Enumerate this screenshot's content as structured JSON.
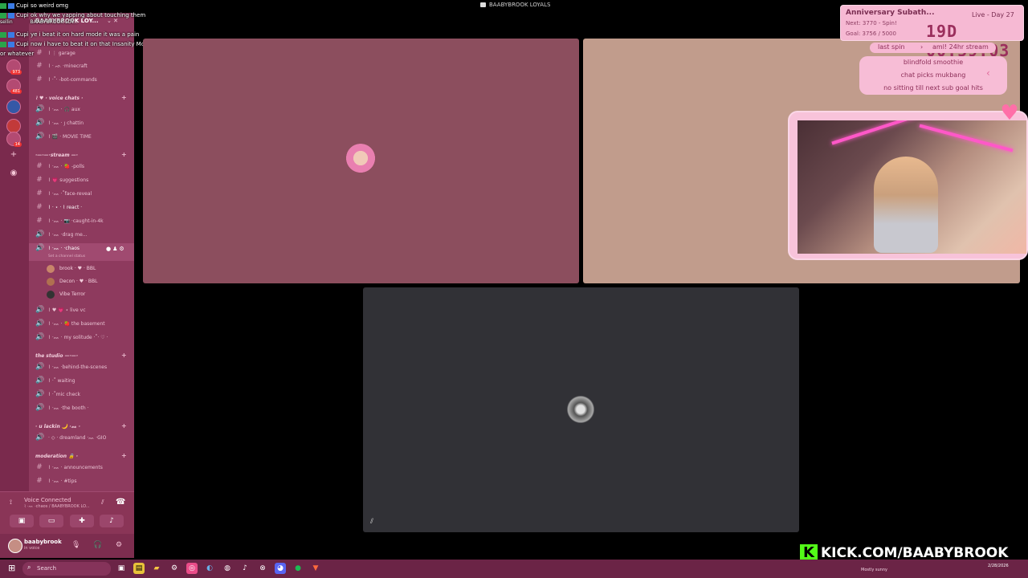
{
  "window": {
    "title": "BAABYBROOK LOYALS"
  },
  "chat": [
    {
      "user": "Cupi",
      "text": "so weird omg"
    },
    {
      "user": "Cupi",
      "text": "ok why we yapping about touching them"
    },
    {
      "user": "Cupi",
      "text": "ye i beat it on hard mode it was a pain"
    },
    {
      "user": "Cupi",
      "text": "now i have to beat it on that Insanity Mode"
    },
    {
      "user": "",
      "text": "or whatever"
    }
  ],
  "chat_extra": {
    "stray_left": "sellin",
    "server_header_overlap": "BAABYBROOK LOY..."
  },
  "server_rail": {
    "badges": [
      "973",
      "481",
      "14"
    ]
  },
  "sidebar": {
    "server_name": "BAABYBROOK LOY...",
    "channels_top": [
      {
        "icon": "#",
        "label": "⌇ ⋮ garage"
      },
      {
        "icon": "#",
        "label": "⌇ · ᨒ ·minecraft"
      },
      {
        "icon": "#",
        "label": "⌇ ·˚· -bot-commands"
      }
    ],
    "cat_voice": "⌇ ♥ · voice chats ·",
    "channels_voice": [
      {
        "icon": "🔊",
        "label": "⌇ ·ᨐ · 🎧 aux"
      },
      {
        "icon": "🔊",
        "label": "⌇ ·ᨐ · ȷ chattin"
      },
      {
        "icon": "🔊",
        "label": "⌇ 🎬 · MOVIE TIME"
      }
    ],
    "cat_stream": "·—·—·stream —·",
    "channels_stream": [
      {
        "icon": "#",
        "label": "⌇ ·ᨐ · 🍓 -polls"
      },
      {
        "icon": "#",
        "label": "⌇ 💗 suggestions"
      },
      {
        "icon": "#",
        "label": "⌇ ·ᨐ ·˚face-reveal"
      },
      {
        "icon": "#",
        "label": "⌇ · ⋆ · ⌇ react ·"
      },
      {
        "icon": "#",
        "label": "⌇ ·ᨐ · 📷 ·caught-in-4k"
      },
      {
        "icon": "🔊",
        "label": "⌇ ·ᨐ ·drag me..."
      },
      {
        "icon": "🔊",
        "label": "⌇ ·ᨐ · ·chaos"
      }
    ],
    "active_status": "Set a channel status",
    "voice_members": [
      {
        "name": "brook · ♥ · BBL"
      },
      {
        "name": "Decon · ♥ · BBL"
      },
      {
        "name": "Vibe Terror"
      }
    ],
    "channels_after": [
      {
        "icon": "🔊",
        "label": "⌇ ♥ 💗 ⋆ live vc"
      },
      {
        "icon": "🔊",
        "label": "⌇ ·ᨐ · 🍓 the basement"
      },
      {
        "icon": "🔊",
        "label": "⌇ ·ᨐ · my solitude ·˚· ♡ ·"
      }
    ],
    "cat_studio": "the studio —·—·",
    "channels_studio": [
      {
        "icon": "🔊",
        "label": "⌇ ·ᨐ ·behind-the-scenes"
      },
      {
        "icon": "🔊",
        "label": "⌇ ·˚ waiting"
      },
      {
        "icon": "🔊",
        "label": "⌇ ·˚mic check"
      },
      {
        "icon": "🔊",
        "label": "⌇ ·ᨐ ·the booth ·"
      }
    ],
    "cat_lackin": "· u lackin 🌙 ·ᨐ ·",
    "channels_lackin": [
      {
        "icon": "🔊",
        "label": "· ◇ · dreamland ·ᨐ ·GIO"
      }
    ],
    "cat_mod": "moderation 🔒 ·",
    "channels_mod": [
      {
        "icon": "#",
        "label": "⌇ ·ᨐ · announcements"
      },
      {
        "icon": "#",
        "label": "⌇ ·ᨐ · #tips"
      }
    ]
  },
  "voice": {
    "connected": "Voice Connected",
    "sub": "⌇ ·ᨐ ·chaos / BAABYBROOK LO..."
  },
  "user": {
    "name": "baabybrook",
    "status": "in voice"
  },
  "stream": {
    "goal_title": "Anniversary Subath...",
    "live": "Live - Day 27",
    "next": "Next: 3770 - Spin!",
    "goal": "Goal: 3756 / 5000",
    "timer": "19D 00:59:03",
    "last_spin": "last spin",
    "last_spin_value": "aml! 24hr stream",
    "rules": [
      "blindfold smoothie",
      "chat picks mukbang",
      "no sitting till next sub goal hits"
    ],
    "kick": "KICK.COM/BAABYBROOK"
  },
  "taskbar": {
    "search": "Search",
    "weather": "Mostly sunny",
    "time": "2/28/2026"
  },
  "colors": {
    "sidebar": "#8e3a5e",
    "accent_pink": "#f6b9d3",
    "kick_green": "#53fc18"
  }
}
